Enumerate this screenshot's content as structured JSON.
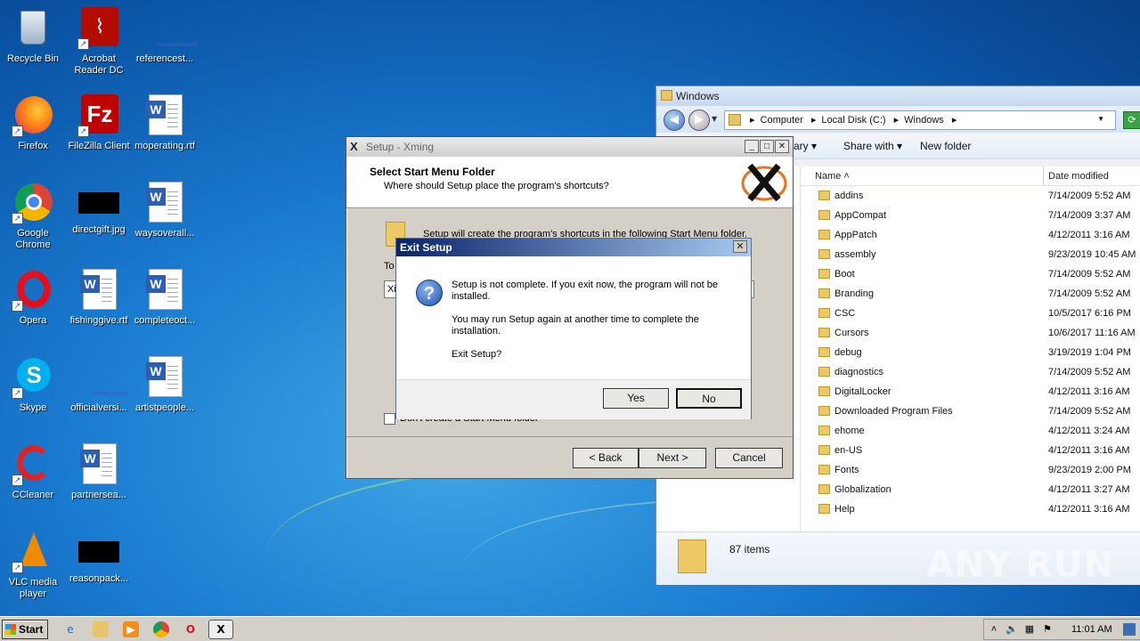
{
  "desktop": {
    "icons": [
      {
        "label": "Recycle Bin"
      },
      {
        "label": "Acrobat Reader DC"
      },
      {
        "label": "referencest..."
      },
      {
        "label": "Firefox"
      },
      {
        "label": "FileZilla Client"
      },
      {
        "label": "moperating.rtf"
      },
      {
        "label": "Google Chrome"
      },
      {
        "label": "directgift.jpg"
      },
      {
        "label": "waysoverall..."
      },
      {
        "label": "Opera"
      },
      {
        "label": "fishinggive.rtf"
      },
      {
        "label": "completeoct..."
      },
      {
        "label": "Skype"
      },
      {
        "label": "officialversi..."
      },
      {
        "label": "artistpeople..."
      },
      {
        "label": "CCleaner"
      },
      {
        "label": "partnersea..."
      },
      {
        "label": "VLC media player"
      },
      {
        "label": "reasonpack..."
      }
    ]
  },
  "explorer": {
    "title": "Windows",
    "breadcrumb": [
      "Computer",
      "Local Disk (C:)",
      "Windows"
    ],
    "toolbar": {
      "library": "rary",
      "share": "Share with",
      "new_folder": "New folder"
    },
    "columns": {
      "name": "Name",
      "date": "Date modified"
    },
    "rows": [
      {
        "name": "addins",
        "date": "7/14/2009 5:52 AM"
      },
      {
        "name": "AppCompat",
        "date": "7/14/2009 3:37 AM"
      },
      {
        "name": "AppPatch",
        "date": "4/12/2011 3:16 AM"
      },
      {
        "name": "assembly",
        "date": "9/23/2019 10:45 AM"
      },
      {
        "name": "Boot",
        "date": "7/14/2009 5:52 AM"
      },
      {
        "name": "Branding",
        "date": "7/14/2009 5:52 AM"
      },
      {
        "name": "CSC",
        "date": "10/5/2017 6:16 PM"
      },
      {
        "name": "Cursors",
        "date": "10/6/2017 11:16 AM"
      },
      {
        "name": "debug",
        "date": "3/19/2019 1:04 PM"
      },
      {
        "name": "diagnostics",
        "date": "7/14/2009 5:52 AM"
      },
      {
        "name": "DigitalLocker",
        "date": "4/12/2011 3:16 AM"
      },
      {
        "name": "Downloaded Program Files",
        "date": "7/14/2009 5:52 AM"
      },
      {
        "name": "ehome",
        "date": "4/12/2011 3:24 AM"
      },
      {
        "name": "en-US",
        "date": "4/12/2011 3:16 AM"
      },
      {
        "name": "Fonts",
        "date": "9/23/2019 2:00 PM"
      },
      {
        "name": "Globalization",
        "date": "4/12/2011 3:27 AM"
      },
      {
        "name": "Help",
        "date": "4/12/2011 3:16 AM"
      }
    ],
    "status": "87 items"
  },
  "setup": {
    "title": "Setup - Xming",
    "heading": "Select Start Menu Folder",
    "subheading": "Where should Setup place the program's shortcuts?",
    "message": "Setup will create the program's shortcuts in the following Start Menu folder.",
    "to_label": "To",
    "folder_value": "Xi",
    "checkbox_label": "Don't create a Start Menu folder",
    "back": "< Back",
    "next": "Next >",
    "cancel": "Cancel"
  },
  "exit_dialog": {
    "title": "Exit Setup",
    "line1": "Setup is not complete. If you exit now, the program will not be installed.",
    "line2": "You may run Setup again at another time to complete the installation.",
    "line3": "Exit Setup?",
    "yes": "Yes",
    "no": "No"
  },
  "taskbar": {
    "start": "Start",
    "time": "11:01 AM"
  },
  "watermark": "ANY RUN"
}
